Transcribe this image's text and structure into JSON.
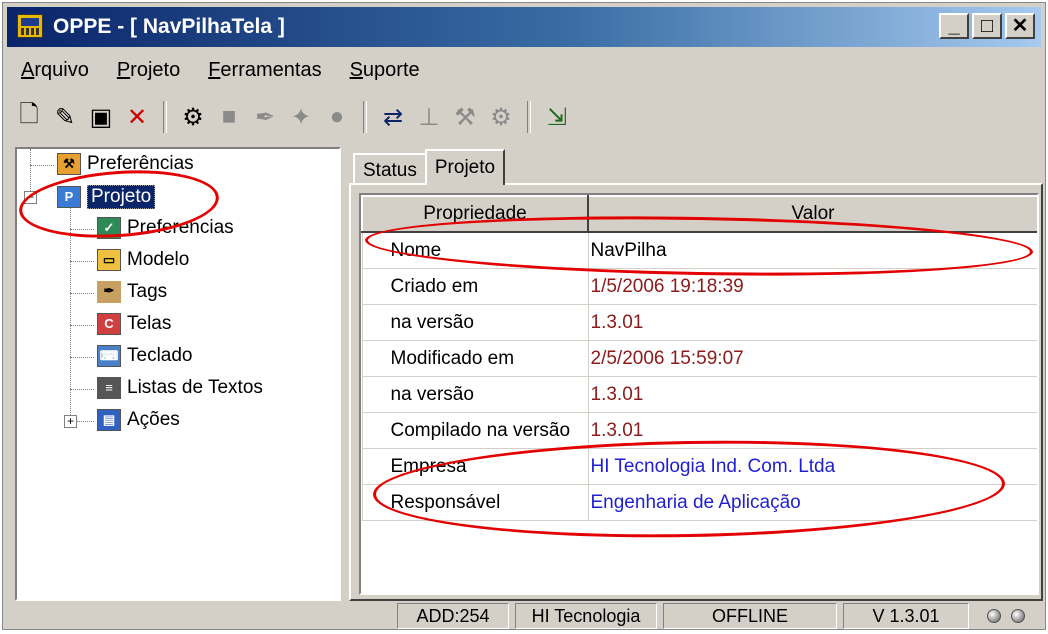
{
  "window": {
    "title": "OPPE - [ NavPilhaTela ]"
  },
  "menu": [
    {
      "u": "A",
      "rest": "rquivo"
    },
    {
      "u": "P",
      "rest": "rojeto"
    },
    {
      "u": "F",
      "rest": "erramentas"
    },
    {
      "u": "S",
      "rest": "uporte"
    }
  ],
  "toolbar": [
    {
      "name": "new-file-icon",
      "glyph": "🗋",
      "enabled": true
    },
    {
      "name": "open-folder-icon",
      "glyph": "✎",
      "enabled": true
    },
    {
      "name": "save-icon",
      "glyph": "▣",
      "enabled": true
    },
    {
      "name": "close-icon",
      "glyph": "✕",
      "enabled": true,
      "color": "#cc0000"
    },
    {
      "sep": true
    },
    {
      "name": "project-settings-icon",
      "glyph": "⚙",
      "enabled": true
    },
    {
      "name": "model-icon",
      "glyph": "■",
      "enabled": false
    },
    {
      "name": "tags-icon",
      "glyph": "✒",
      "enabled": false
    },
    {
      "name": "screens-icon",
      "glyph": "✦",
      "enabled": false
    },
    {
      "name": "record-icon",
      "glyph": "●",
      "enabled": false
    },
    {
      "sep": true
    },
    {
      "name": "connect-icon",
      "glyph": "⇄",
      "enabled": true,
      "color": "#0a246a"
    },
    {
      "name": "network-icon",
      "glyph": "⊥",
      "enabled": false
    },
    {
      "name": "compile-icon",
      "glyph": "⚒",
      "enabled": false
    },
    {
      "name": "download-icon",
      "glyph": "⚙",
      "enabled": false
    },
    {
      "sep": true
    },
    {
      "name": "exit-icon",
      "glyph": "⇲",
      "enabled": true,
      "color": "#1a6a1a"
    }
  ],
  "tree": {
    "preferences_root": "Preferências",
    "project": "Projeto",
    "children": [
      "Preferencias",
      "Modelo",
      "Tags",
      "Telas",
      "Teclado",
      "Listas de Textos",
      "Ações"
    ]
  },
  "tabs": [
    "Status",
    "Projeto"
  ],
  "grid": {
    "headers": [
      "Propriedade",
      "Valor"
    ],
    "rows": [
      {
        "prop": "Nome",
        "value": "NavPilha"
      },
      {
        "prop": "Criado em",
        "value": "1/5/2006 19:18:39"
      },
      {
        "prop": "na versão",
        "value": "1.3.01"
      },
      {
        "prop": "Modificado em",
        "value": "2/5/2006 15:59:07"
      },
      {
        "prop": "na versão",
        "value": "1.3.01"
      },
      {
        "prop": "Compilado na versão",
        "value": "1.3.01"
      },
      {
        "prop": "Empresa",
        "value": "HI Tecnologia Ind. Com. Ltda"
      },
      {
        "prop": "Responsável",
        "value": "Engenharia de Aplicação"
      }
    ]
  },
  "status": {
    "address": "ADD:254",
    "vendor": "HI Tecnologia",
    "mode": "OFFLINE",
    "version": "V 1.3.01"
  },
  "colors": {
    "title_bar": "#0a246a",
    "value_dark_red": "#8b1a1a",
    "value_blue": "#1f1fd0",
    "annotation_red": "#e30000"
  }
}
